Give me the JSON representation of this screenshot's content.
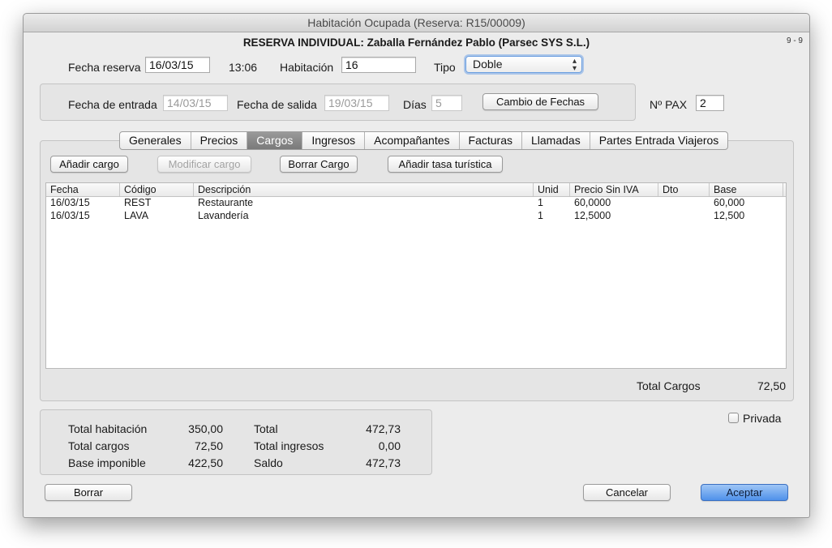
{
  "window": {
    "title": "Habitación Ocupada (Reserva: R15/00009)"
  },
  "header": {
    "title": "RESERVA INDIVIDUAL: Zaballa Fernández Pablo (Parsec SYS S.L.)",
    "page_indicator": "9 - 9"
  },
  "reserva": {
    "fecha_label": "Fecha reserva",
    "fecha_value": "16/03/15",
    "hora": "13:06",
    "habitacion_label": "Habitación",
    "habitacion_value": "16",
    "tipo_label": "Tipo",
    "tipo_value": "Doble"
  },
  "fechas": {
    "entrada_label": "Fecha de entrada",
    "entrada_value": "14/03/15",
    "salida_label": "Fecha de salida",
    "salida_value": "19/03/15",
    "dias_label": "Días",
    "dias_value": "5",
    "cambio_button": "Cambio de Fechas",
    "pax_label": "Nº PAX",
    "pax_value": "2"
  },
  "tabs": [
    "Generales",
    "Precios",
    "Cargos",
    "Ingresos",
    "Acompañantes",
    "Facturas",
    "Llamadas",
    "Partes Entrada Viajeros"
  ],
  "active_tab": "Cargos",
  "cargos_toolbar": {
    "add": "Añadir cargo",
    "modify": "Modificar cargo",
    "delete": "Borrar Cargo",
    "add_tasa": "Añadir tasa turística"
  },
  "table": {
    "columns": [
      "Fecha",
      "Código",
      "Descripción",
      "Unid",
      "Precio Sin IVA",
      "Dto",
      "Base"
    ],
    "rows": [
      [
        "16/03/15",
        "REST",
        "Restaurante",
        "1",
        "60,0000",
        "",
        "60,000"
      ],
      [
        "16/03/15",
        "LAVA",
        "Lavandería",
        "1",
        "12,5000",
        "",
        "12,500"
      ]
    ]
  },
  "total_cargos": {
    "label": "Total Cargos",
    "value": "72,50"
  },
  "summary": {
    "total_habitacion_label": "Total habitación",
    "total_habitacion_value": "350,00",
    "total_cargos_label": "Total cargos",
    "total_cargos_value": "72,50",
    "base_imponible_label": "Base imponible",
    "base_imponible_value": "422,50",
    "total_label": "Total",
    "total_value": "472,73",
    "total_ingresos_label": "Total ingresos",
    "total_ingresos_value": "0,00",
    "saldo_label": "Saldo",
    "saldo_value": "472,73"
  },
  "privada": {
    "label": "Privada",
    "checked": false
  },
  "footer": {
    "borrar": "Borrar",
    "cancelar": "Cancelar",
    "aceptar": "Aceptar"
  },
  "colors": {
    "accent": "#4f91ea",
    "active_tab": "#8a8a8a",
    "window_bg": "#ececec"
  }
}
